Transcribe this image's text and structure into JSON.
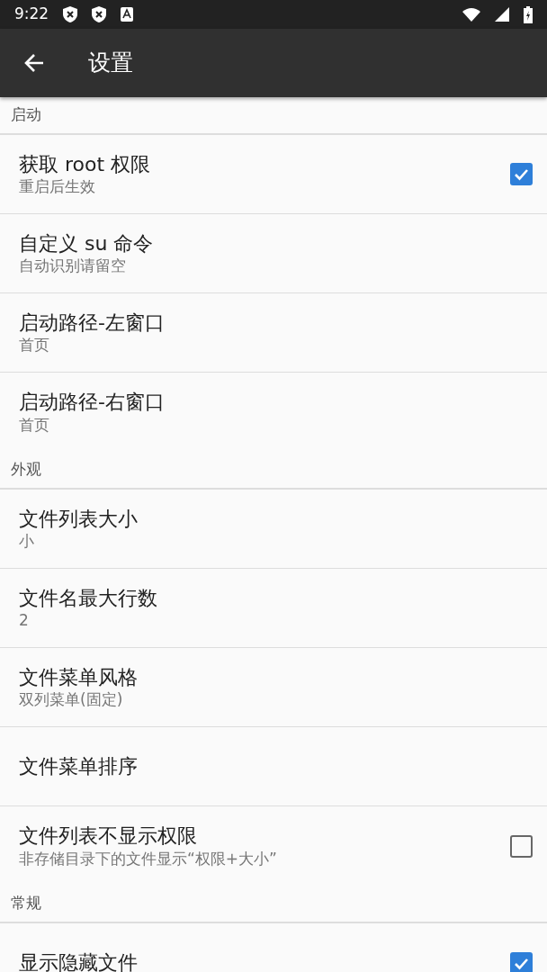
{
  "status_bar": {
    "time": "9:22"
  },
  "app_bar": {
    "title": "设置"
  },
  "sections": [
    {
      "header": "启动",
      "items": [
        {
          "title": "获取 root 权限",
          "summary": "重启后生效",
          "kind": "checkbox",
          "checked": true
        },
        {
          "title": "自定义 su 命令",
          "summary": "自动识别请留空",
          "kind": "plain"
        },
        {
          "title": "启动路径-左窗口",
          "summary": "首页",
          "kind": "plain"
        },
        {
          "title": "启动路径-右窗口",
          "summary": "首页",
          "kind": "plain"
        }
      ]
    },
    {
      "header": "外观",
      "items": [
        {
          "title": "文件列表大小",
          "summary": "小",
          "kind": "plain"
        },
        {
          "title": "文件名最大行数",
          "summary": "2",
          "kind": "plain"
        },
        {
          "title": "文件菜单风格",
          "summary": "双列菜单(固定)",
          "kind": "plain"
        },
        {
          "title": "文件菜单排序",
          "kind": "plain"
        },
        {
          "title": "文件列表不显示权限",
          "summary": "非存储目录下的文件显示“权限+大小”",
          "kind": "checkbox",
          "checked": false
        }
      ]
    },
    {
      "header": "常规",
      "items": [
        {
          "title": "显示隐藏文件",
          "kind": "checkbox",
          "checked": true
        }
      ]
    }
  ]
}
